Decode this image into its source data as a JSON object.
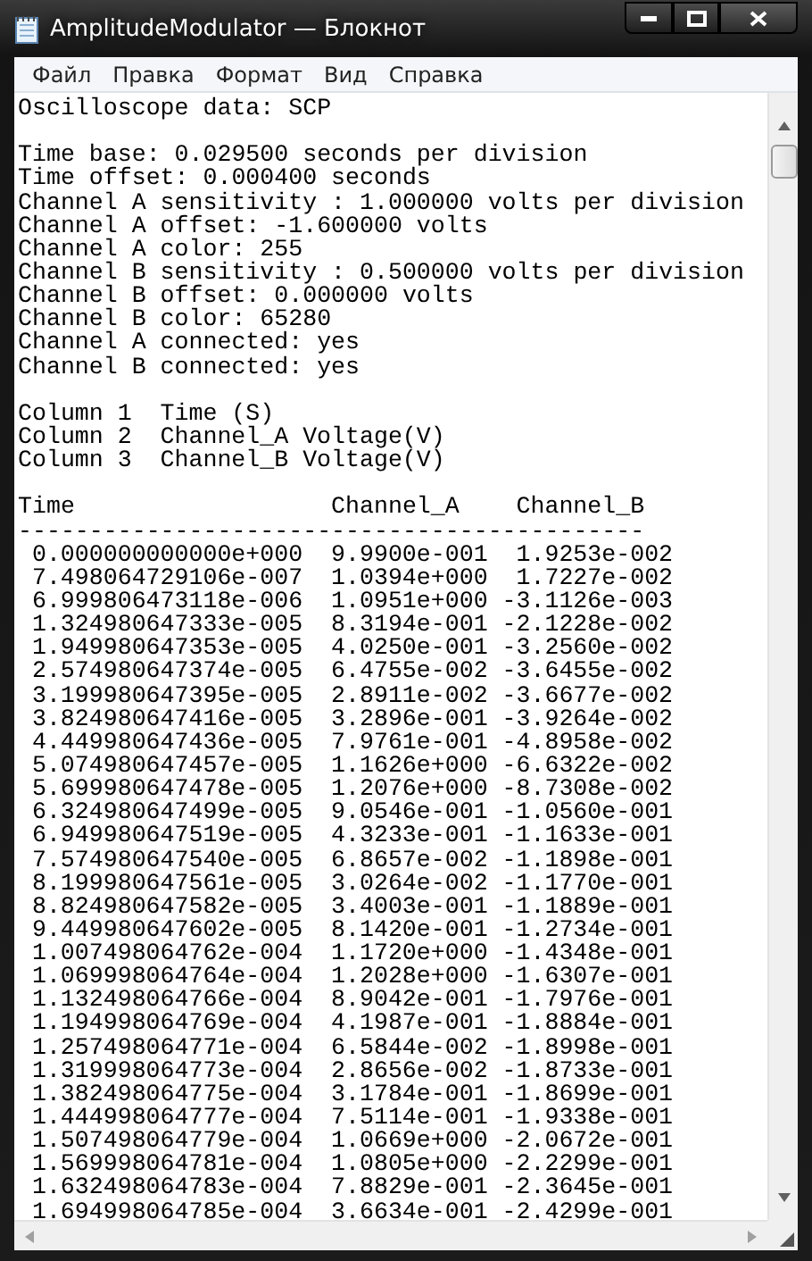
{
  "window": {
    "title": "AmplitudeModulator — Блокнот"
  },
  "menu": [
    "Файл",
    "Правка",
    "Формат",
    "Вид",
    "Справка"
  ],
  "document": {
    "header": "Oscilloscope data: SCP",
    "settings": [
      "Time base: 0.029500 seconds per division",
      "Time offset: 0.000400 seconds",
      "Channel A sensitivity : 1.000000 volts per division",
      "Channel A offset: -1.600000 volts",
      "Channel A color: 255",
      "Channel B sensitivity : 0.500000 volts per division",
      "Channel B offset: 0.000000 volts",
      "Channel B color: 65280",
      "Channel A connected: yes",
      "Channel B connected: yes"
    ],
    "columns": [
      {
        "label": "Column 1",
        "name": "Time (S)"
      },
      {
        "label": "Column 2",
        "name": "Channel_A Voltage(V)"
      },
      {
        "label": "Column 3",
        "name": "Channel_B Voltage(V)"
      }
    ],
    "table": {
      "columns": [
        "Time",
        "Channel_A",
        "Channel_B"
      ],
      "separator": "--------------------------------------------",
      "rows": [
        [
          "0.000000000000e+000",
          "9.9900e-001",
          "1.9253e-002"
        ],
        [
          "7.498064729106e-007",
          "1.0394e+000",
          "1.7227e-002"
        ],
        [
          "6.999806473118e-006",
          "1.0951e+000",
          "-3.1126e-003"
        ],
        [
          "1.324980647333e-005",
          "8.3194e-001",
          "-2.1228e-002"
        ],
        [
          "1.949980647353e-005",
          "4.0250e-001",
          "-3.2560e-002"
        ],
        [
          "2.574980647374e-005",
          "6.4755e-002",
          "-3.6455e-002"
        ],
        [
          "3.199980647395e-005",
          "2.8911e-002",
          "-3.6677e-002"
        ],
        [
          "3.824980647416e-005",
          "3.2896e-001",
          "-3.9264e-002"
        ],
        [
          "4.449980647436e-005",
          "7.9761e-001",
          "-4.8958e-002"
        ],
        [
          "5.074980647457e-005",
          "1.1626e+000",
          "-6.6322e-002"
        ],
        [
          "5.699980647478e-005",
          "1.2076e+000",
          "-8.7308e-002"
        ],
        [
          "6.324980647499e-005",
          "9.0546e-001",
          "-1.0560e-001"
        ],
        [
          "6.949980647519e-005",
          "4.3233e-001",
          "-1.1633e-001"
        ],
        [
          "7.574980647540e-005",
          "6.8657e-002",
          "-1.1898e-001"
        ],
        [
          "8.199980647561e-005",
          "3.0264e-002",
          "-1.1770e-001"
        ],
        [
          "8.824980647582e-005",
          "3.4003e-001",
          "-1.1889e-001"
        ],
        [
          "9.449980647602e-005",
          "8.1420e-001",
          "-1.2734e-001"
        ],
        [
          "1.007498064762e-004",
          "1.1720e+000",
          "-1.4348e-001"
        ],
        [
          "1.069998064764e-004",
          "1.2028e+000",
          "-1.6307e-001"
        ],
        [
          "1.132498064766e-004",
          "8.9042e-001",
          "-1.7976e-001"
        ],
        [
          "1.194998064769e-004",
          "4.1987e-001",
          "-1.8884e-001"
        ],
        [
          "1.257498064771e-004",
          "6.5844e-002",
          "-1.8998e-001"
        ],
        [
          "1.319998064773e-004",
          "2.8656e-002",
          "-1.8733e-001"
        ],
        [
          "1.382498064775e-004",
          "3.1784e-001",
          "-1.8699e-001"
        ],
        [
          "1.444998064777e-004",
          "7.5114e-001",
          "-1.9338e-001"
        ],
        [
          "1.507498064779e-004",
          "1.0669e+000",
          "-2.0672e-001"
        ],
        [
          "1.569998064781e-004",
          "1.0805e+000",
          "-2.2299e-001"
        ],
        [
          "1.632498064783e-004",
          "7.8829e-001",
          "-2.3645e-001"
        ],
        [
          "1.694998064785e-004",
          "3.6634e-001",
          "-2.4299e-001"
        ]
      ]
    }
  }
}
